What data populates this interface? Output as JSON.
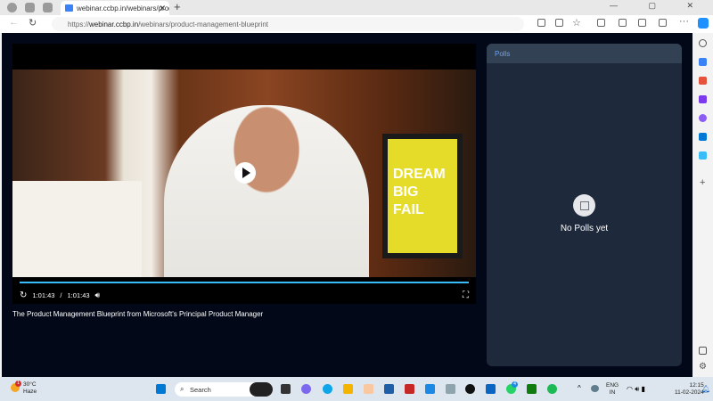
{
  "browser": {
    "tab_title": "webinar.ccbp.in/webinars/produ",
    "url_prefix": "https://",
    "url_host": "webinar.ccbp.in",
    "url_path": "/webinars/product-management-blueprint",
    "new_tab": "+",
    "close": "✕",
    "window_controls": "— ▢ ✕"
  },
  "video": {
    "current_time": "1:01:43",
    "separator": "/",
    "duration": "1:01:43",
    "progress": 1.0,
    "poster_text": "DREAM BIG FAIL"
  },
  "webinar_title": "The Product Management Blueprint from Microsoft's Principal Product Manager",
  "polls": {
    "header": "Polls",
    "empty_text": "No Polls yet"
  },
  "taskbar": {
    "temperature": "30°C",
    "weather": "Haze",
    "search_placeholder": "Search",
    "lang1": "ENG",
    "lang2": "IN",
    "time": "12:15",
    "date": "11-02-2024",
    "weather_badge": "1",
    "whatsapp_badge": "4"
  }
}
